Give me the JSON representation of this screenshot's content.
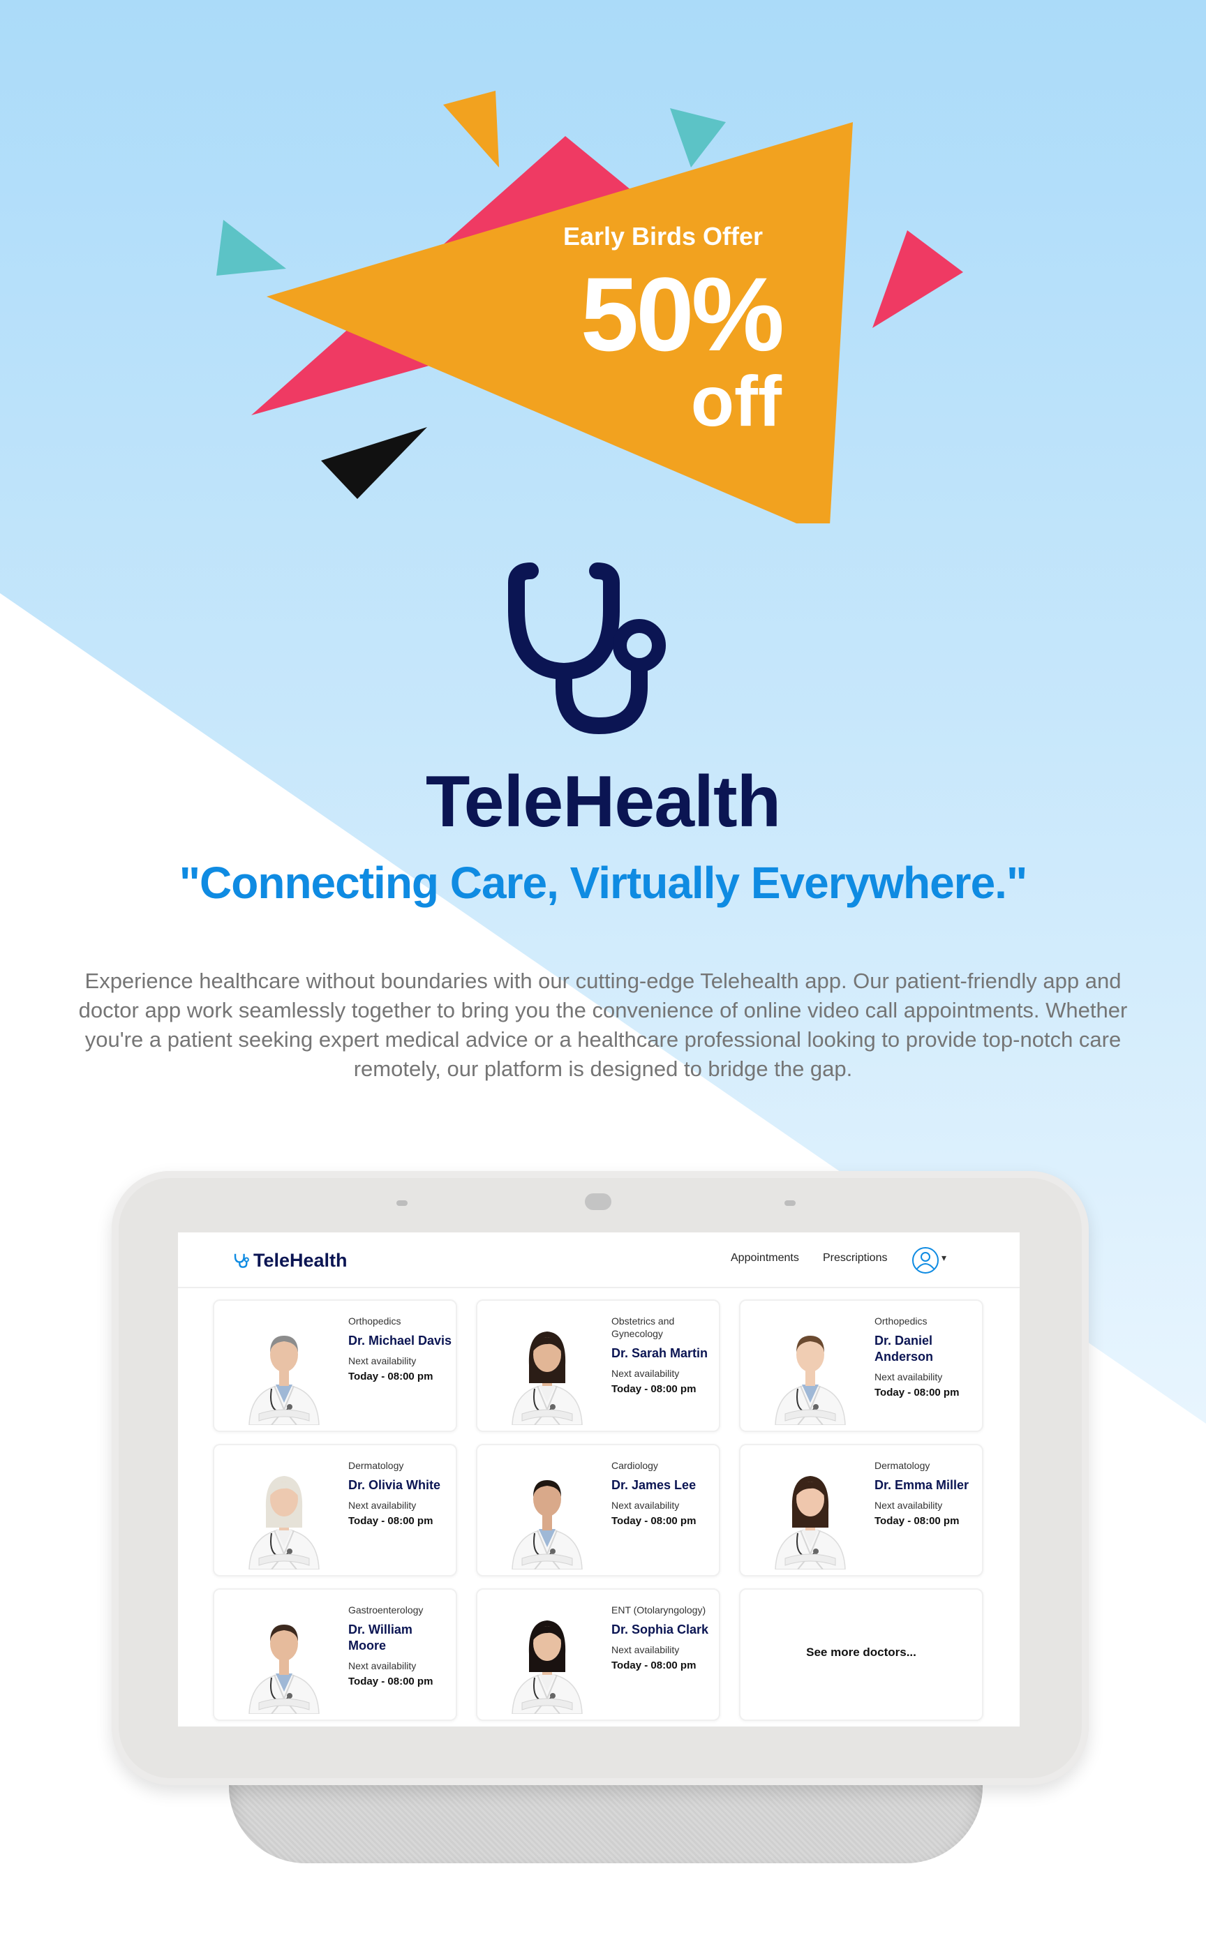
{
  "colors": {
    "sky": "#aedcf9",
    "brand_navy": "#0b1553",
    "brand_blue": "#0f8be2",
    "offer_orange": "#f2a21f",
    "offer_pink": "#ef3a63",
    "offer_teal": "#5cc3c6"
  },
  "promo": {
    "eyebrow": "Early Birds Offer",
    "discount": "50%",
    "suffix": "off"
  },
  "brand": {
    "icon": "stethoscope-icon",
    "title": "TeleHealth",
    "tagline": "\"Connecting Care, Virtually Everywhere.\"",
    "description": "Experience healthcare without boundaries with our cutting-edge Telehealth app. Our patient-friendly app and doctor app work seamlessly together to bring you the convenience of online video call appointments. Whether you're a patient seeking expert medical advice or a healthcare professional looking to provide top-notch care remotely, our platform is designed to bridge the gap."
  },
  "app": {
    "logo": "TeleHealth",
    "nav": {
      "appointments": "Appointments",
      "prescriptions": "Prescriptions"
    },
    "user_icon": "user-avatar-icon",
    "doctors": [
      {
        "specialty": "Orthopedics",
        "name": "Dr. Michael Davis",
        "availability_label": "Next availability",
        "availability_time": "Today - 08:00 pm",
        "gender": "male"
      },
      {
        "specialty": "Obstetrics and Gynecology",
        "name": "Dr. Sarah Martin",
        "availability_label": "Next availability",
        "availability_time": "Today - 08:00 pm",
        "gender": "female"
      },
      {
        "specialty": "Orthopedics",
        "name": "Dr. Daniel Anderson",
        "availability_label": "Next availability",
        "availability_time": "Today - 08:00 pm",
        "gender": "male"
      },
      {
        "specialty": "Dermatology",
        "name": "Dr. Olivia White",
        "availability_label": "Next availability",
        "availability_time": "Today - 08:00 pm",
        "gender": "female"
      },
      {
        "specialty": "Cardiology",
        "name": "Dr. James Lee",
        "availability_label": "Next availability",
        "availability_time": "Today - 08:00 pm",
        "gender": "male"
      },
      {
        "specialty": "Dermatology",
        "name": "Dr. Emma Miller",
        "availability_label": "Next availability",
        "availability_time": "Today - 08:00 pm",
        "gender": "female"
      },
      {
        "specialty": "Gastroenterology",
        "name": "Dr. William Moore",
        "availability_label": "Next availability",
        "availability_time": "Today - 08:00 pm",
        "gender": "male"
      },
      {
        "specialty": "ENT (Otolaryngology)",
        "name": "Dr. Sophia Clark",
        "availability_label": "Next availability",
        "availability_time": "Today - 08:00 pm",
        "gender": "female"
      }
    ],
    "see_more": "See more doctors..."
  }
}
